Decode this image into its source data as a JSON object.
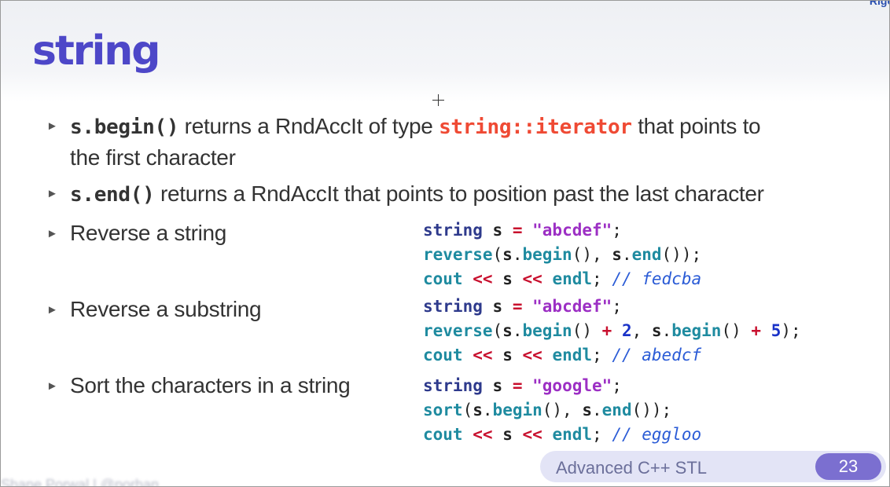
{
  "slide": {
    "title": "string",
    "corner_text": "Rigo",
    "bullets": [
      {
        "code": "s.begin()",
        "text1": " returns a RndAccIt of type ",
        "highlight": "string::iterator",
        "text2": " that points to",
        "line2": "the first character"
      },
      {
        "code": "s.end()",
        "text1": " returns a RndAccIt that points to position past the last character"
      },
      {
        "text": "Reverse a string"
      },
      {
        "text": "Reverse a substring"
      },
      {
        "text": "Sort the characters in a string"
      }
    ],
    "code_examples": [
      {
        "str_literal": "\"abcdef\"",
        "comment": "// fedcba"
      },
      {
        "str_literal": "\"abcdef\"",
        "num_a": "2",
        "num_b": "5",
        "comment": "// abedcf"
      },
      {
        "str_literal": "\"google\"",
        "comment": "// eggloo"
      }
    ],
    "footer": {
      "label": "Advanced C++ STL",
      "page": "23"
    },
    "bottom_left_text": "Shane Porwal | @porhan"
  }
}
